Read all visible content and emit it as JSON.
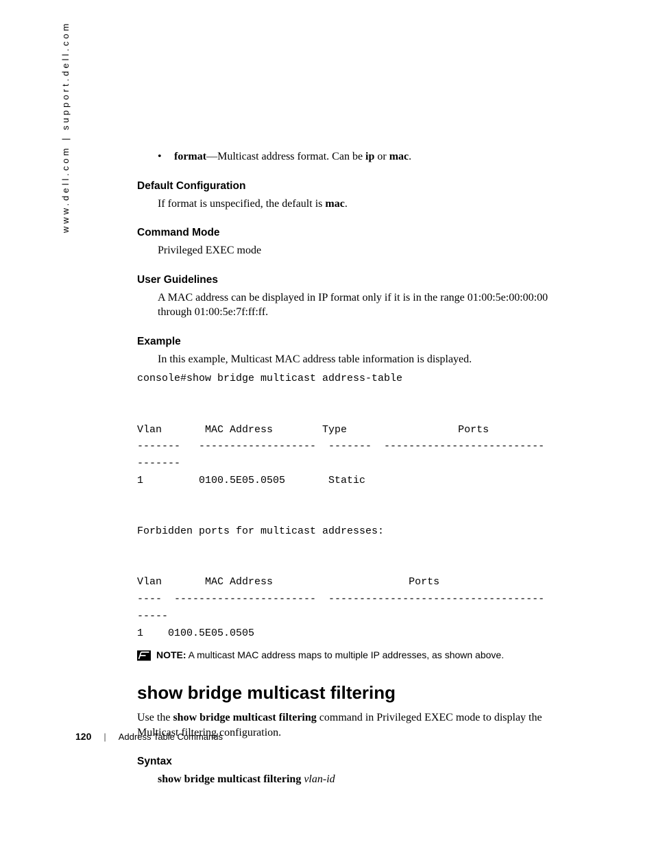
{
  "side_url": "www.dell.com | support.dell.com",
  "bullet": {
    "term": "format",
    "sep": "—",
    "desc1": "Multicast address format. Can be ",
    "opt1": "ip",
    "mid": " or ",
    "opt2": "mac",
    "tail": "."
  },
  "sections": {
    "default_cfg": {
      "title": "Default Configuration",
      "pre": "If format is unspecified, the default is ",
      "bold": "mac",
      "post": "."
    },
    "cmd_mode": {
      "title": "Command Mode",
      "text": "Privileged EXEC mode"
    },
    "user_guidelines": {
      "title": "User Guidelines",
      "text": "A MAC address can be displayed in IP format only if it is in the range 01:00:5e:00:00:00 through 01:00:5e:7f:ff:ff."
    },
    "example": {
      "title": "Example",
      "text": "In this example, Multicast MAC address table information is displayed."
    }
  },
  "console_block": "console#show bridge multicast address-table\n\n\nVlan       MAC Address        Type                  Ports\n-------   -------------------  -------  --------------------------\n-------\n1         0100.5E05.0505       Static\n\n\nForbidden ports for multicast addresses:\n\n\nVlan       MAC Address                      Ports\n----  -----------------------  -----------------------------------\n-----\n1    0100.5E05.0505",
  "note": {
    "label": "NOTE:",
    "text": " A multicast MAC address maps to multiple IP addresses, as shown above."
  },
  "cmd": {
    "title": "show bridge multicast filtering",
    "pre": "Use the ",
    "bold": "show bridge multicast filtering",
    "post": " command in Privileged EXEC mode to display the Multicast filtering configuration."
  },
  "syntax": {
    "title": "Syntax",
    "bold": "show bridge multicast filtering",
    "ital": "vlan-id"
  },
  "footer": {
    "page": "120",
    "sep": "|",
    "section": "Address Table Commands"
  }
}
